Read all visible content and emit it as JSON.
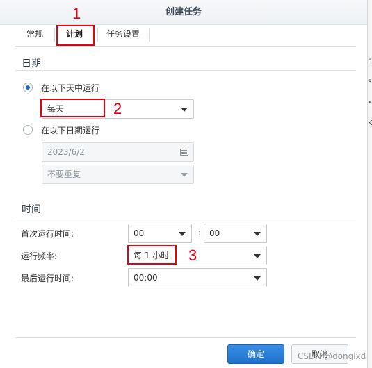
{
  "dialog": {
    "title": "创建任务"
  },
  "tabs": [
    {
      "label": "常规"
    },
    {
      "label": "计划"
    },
    {
      "label": "任务设置"
    }
  ],
  "annotations": {
    "n1": "1",
    "n2": "2",
    "n3": "3"
  },
  "date_section": {
    "title": "日期",
    "option_days": "在以下天中运行",
    "days_value": "每天",
    "option_date": "在以下日期运行",
    "date_value": "2023/6/2",
    "repeat_value": "不要重复",
    "selected": "days"
  },
  "time_section": {
    "title": "时间",
    "first_run_label": "首次运行时间:",
    "hour_value": "00",
    "colon": ":",
    "minute_value": "00",
    "frequency_label": "运行频率:",
    "frequency_value": "每 1 小时",
    "last_run_label": "最后运行时间:",
    "last_run_value": "00:00"
  },
  "footer": {
    "ok_label": "确定",
    "cancel_label": "取消"
  },
  "background_text": {
    "c1": "r",
    "c2": "s",
    "c3": "<",
    "c4": "K"
  },
  "watermark": "CSDN @donglxd",
  "colors": {
    "accent": "#1f72c8",
    "annotation": "#e60012"
  }
}
